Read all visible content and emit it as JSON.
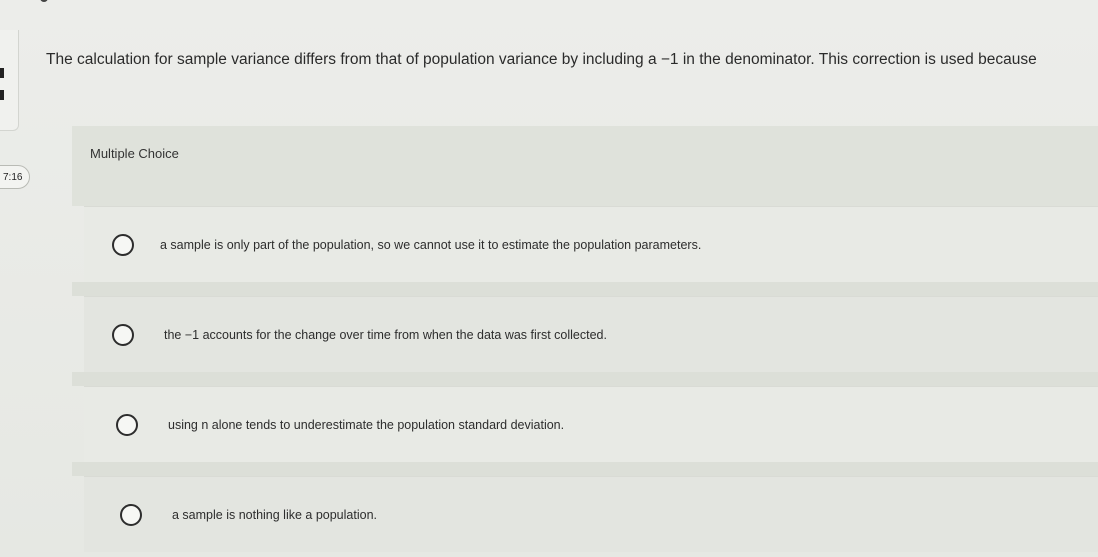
{
  "question": {
    "text": "The calculation for sample variance differs from that of population variance by including a −1 in the denominator. This correction is used because"
  },
  "section": {
    "label": "Multiple Choice"
  },
  "timer": {
    "text": "7:16"
  },
  "options": [
    {
      "text": "a sample is only part of the population, so we cannot use it to estimate the population parameters."
    },
    {
      "text": "the −1 accounts for the change over time from when the data was first collected."
    },
    {
      "text": "using n alone tends to underestimate the population standard deviation."
    },
    {
      "text": "a sample is nothing like a population."
    }
  ]
}
